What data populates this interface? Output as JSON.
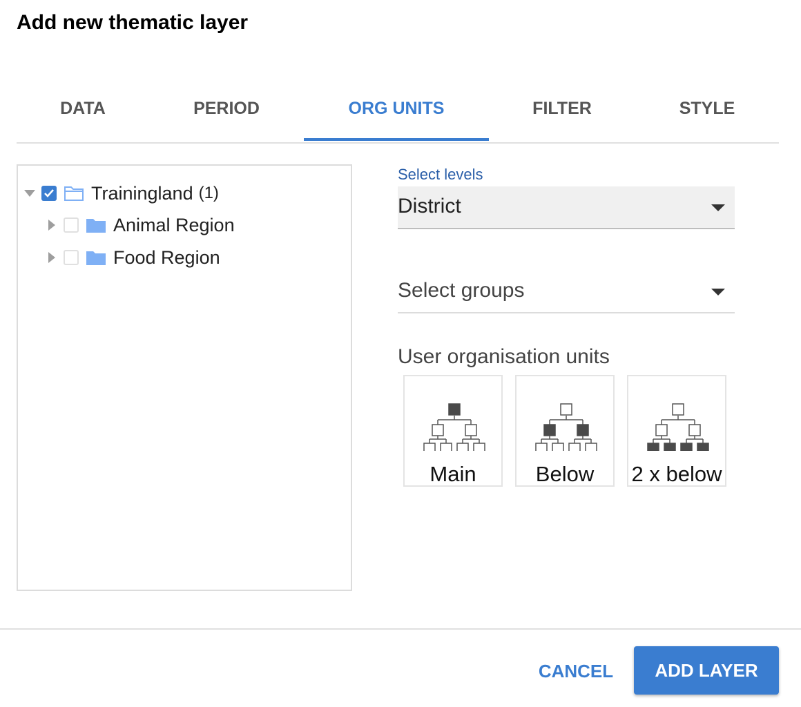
{
  "dialog": {
    "title": "Add new thematic layer"
  },
  "tabs": [
    {
      "label": "DATA",
      "active": false
    },
    {
      "label": "PERIOD",
      "active": false
    },
    {
      "label": "ORG UNITS",
      "active": true
    },
    {
      "label": "FILTER",
      "active": false
    },
    {
      "label": "STYLE",
      "active": false
    }
  ],
  "tree": {
    "root": {
      "label": "Trainingland",
      "count": "(1)",
      "checked": true,
      "expanded": true
    },
    "children": [
      {
        "label": "Animal Region",
        "checked": false,
        "expanded": false
      },
      {
        "label": "Food Region",
        "checked": false,
        "expanded": false
      }
    ]
  },
  "levels": {
    "caption": "Select levels",
    "value": "District"
  },
  "groups": {
    "placeholder": "Select groups"
  },
  "user_org_units": {
    "label": "User organisation units",
    "options": [
      {
        "label": "Main",
        "selected": false
      },
      {
        "label": "Below",
        "selected": false
      },
      {
        "label": "2 x below",
        "selected": false
      }
    ]
  },
  "footer": {
    "cancel_label": "CANCEL",
    "add_label": "ADD LAYER"
  },
  "colors": {
    "accent": "#3a7dd0",
    "folder": "#7fb0f5",
    "icon_fill": "#4a4a4a"
  }
}
